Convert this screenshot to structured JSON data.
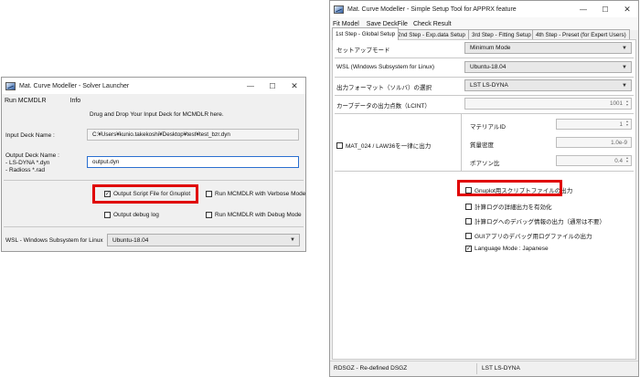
{
  "launcher": {
    "title": "Mat. Curve Modeller - Solver Launcher",
    "menu": [
      "Run MCMDLR",
      "Info"
    ],
    "drop_hint": "Drug and Drop Your Input Deck for MCMDLR here.",
    "input_label": "Input Deck Name :",
    "input_value": "C:¥Users¥kunio.takekoshi¥Desktop¥test¥test_bzr.dyn",
    "output_label_1": "Output Deck Name :",
    "output_label_2": "- LS-DYNA *.dyn",
    "output_label_3": "- Radioss *.rad",
    "output_value": "output.dyn",
    "options": {
      "gnuplot": "Output Script File for Gnuplot",
      "verbose": "Run MCMDLR with Verbose Mode",
      "debug_log": "Output debug log",
      "debug_mode": "Run MCMDLR with Debug Mode"
    },
    "gnuplot_checked": true,
    "wsl_label": "WSL - Windows Subsystem for Linux",
    "wsl_value": "Ubuntu-18.04"
  },
  "setup": {
    "title": "Mat. Curve Modeller - Simple Setup Tool for APPRX feature",
    "menu": [
      "Fit Model",
      "Save DeckFile",
      "Check Result"
    ],
    "tabs": [
      "1st Step - Global Setup",
      "2nd Step - Exp.data Setup",
      "3rd Step - Fitting Setup",
      "4th Step - Preset (for Expert Users)"
    ],
    "rows": {
      "setup_mode_label": "セットアップモード",
      "setup_mode_value": "Minimum Mode",
      "wsl_label": "WSL (Windows Subsystem for Linux)",
      "wsl_value": "Ubuntu-18.04",
      "format_label": "出力フォーマット（ソルバ）の選択",
      "format_value": "LST LS-DYNA",
      "lcint_label": "カーブデータの出力点数（LCINT）",
      "lcint_value": "1001",
      "mat_label": "MAT_024 / LAW36を一律に出力",
      "matid_label": "マテリアルID",
      "matid_value": "1",
      "density_label": "質量密度",
      "density_value": "1.0e-9",
      "poisson_label": "ポアソン比",
      "poisson_value": "0.4"
    },
    "options": {
      "gnuplot": "Gnuplot用スクリプトファイルの出力",
      "detail_log": "計算ログの詳細出力を有効化",
      "debug_info": "計算ログへのデバッグ情報の出力（通常は不要）",
      "gui_log": "GUIアプリのデバッグ用ログファイルの出力",
      "language": "Language Mode : Japanese"
    },
    "language_checked": true,
    "status_left": "RDSGZ - Re-defined DSGZ",
    "status_right": "LST LS-DYNA"
  },
  "icons": {
    "minimize": "—",
    "maximize": "☐",
    "close": "✕",
    "check": "✓",
    "dropdown": "▼",
    "spin_up": "▲",
    "spin_down": "▼"
  },
  "colors": {
    "highlight": "#e00000",
    "window_bg": "#f0f0f0"
  }
}
